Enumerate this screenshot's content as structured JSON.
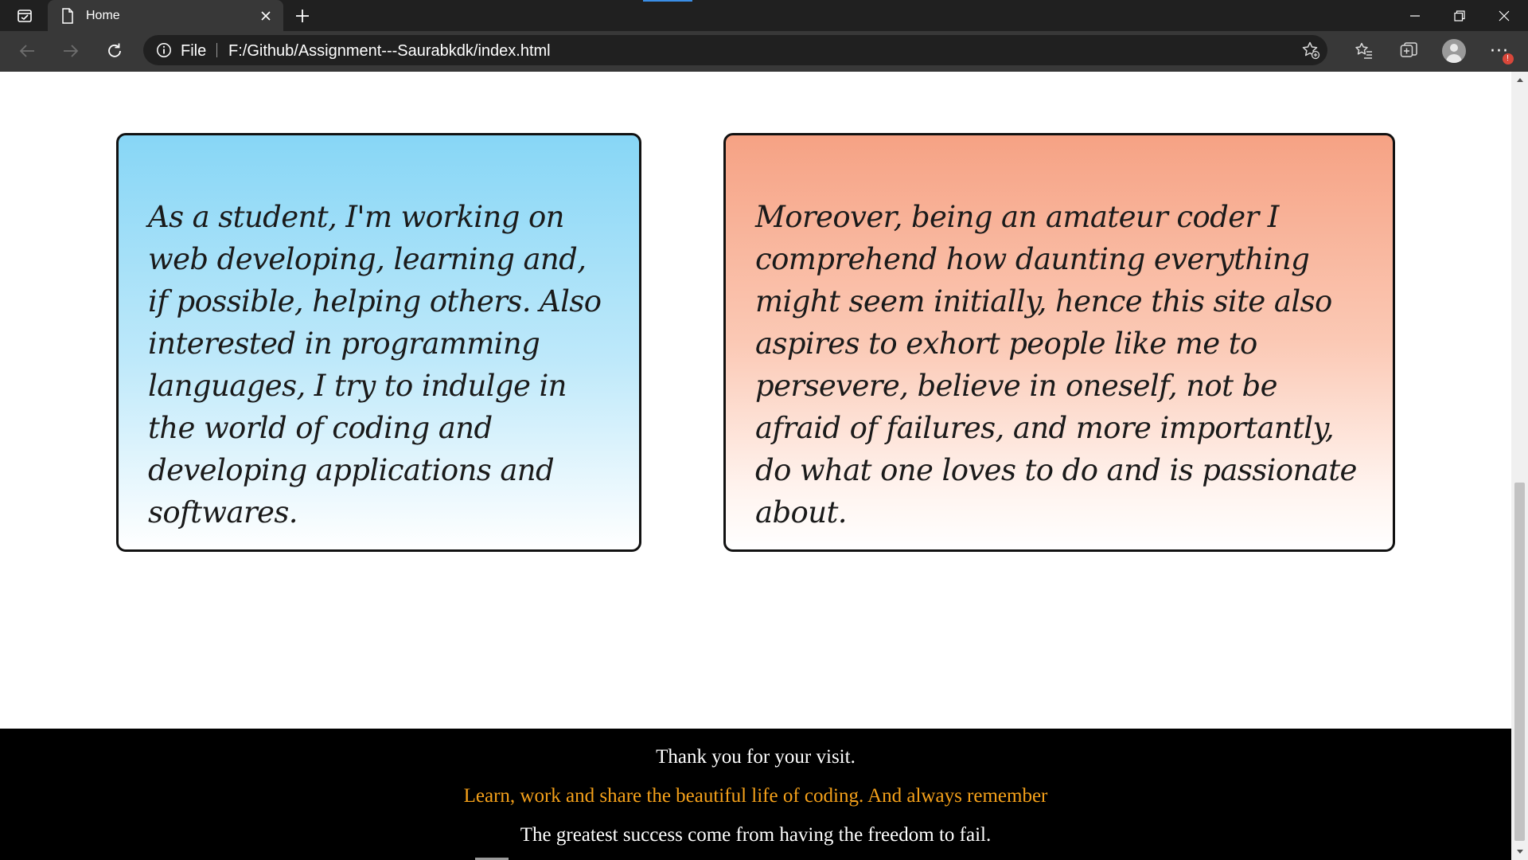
{
  "browser": {
    "tab_title": "Home",
    "omnibox": {
      "scheme": "File",
      "url": "F:/Github/Assignment---Saurabkdk/index.html"
    },
    "notification_badge": "!",
    "icons": [
      "tab-actions-icon",
      "document-icon",
      "close-icon",
      "plus-icon",
      "minimize-icon",
      "restore-icon",
      "close-window-icon",
      "back-arrow-icon",
      "forward-arrow-icon",
      "reload-icon",
      "info-icon",
      "add-favorite-icon",
      "favorites-icon",
      "collections-icon",
      "profile-icon",
      "more-icon"
    ]
  },
  "page": {
    "cards": [
      {
        "text": "As a student, I'm working on web developing, learning and, if possible, helping others. Also interested in programming languages, I try to indulge in the world of coding and developing applications and softwares.",
        "gradient": [
          "#87d6f6",
          "#ffffff"
        ]
      },
      {
        "text": "Moreover, being an amateur coder I comprehend how daunting everything might seem initially, hence this site also aspires to exhort people like me to persevere, believe in oneself, not be afraid of failures, and more importantly, do what one loves to do and is passionate about.",
        "gradient": [
          "#f6a284",
          "#ffffff"
        ]
      }
    ],
    "footer": {
      "line1": "Thank you for your visit.",
      "line2": "Learn, work and share the beautiful life of coding. And always remember",
      "line3": "The greatest success come from having the freedom to fail.",
      "highlight_color": "#f5a11a"
    }
  }
}
